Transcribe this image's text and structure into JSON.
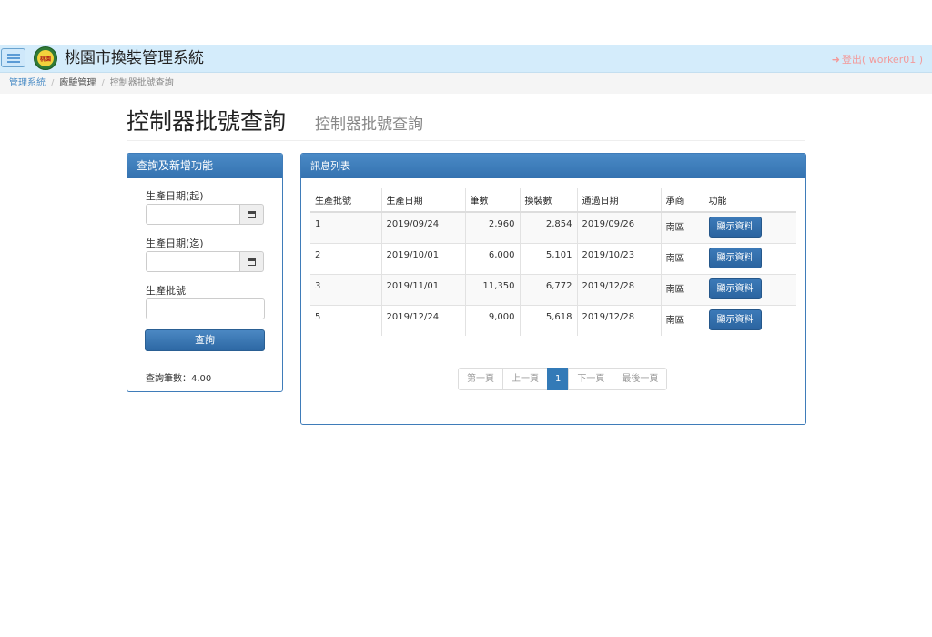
{
  "header": {
    "brand": "桃園市換裝管理系統",
    "logo_text": "桃園",
    "logout_label": "登出( worker01 )",
    "menu_icon": "hamburger-menu-icon",
    "logout_icon": "sign-out-icon"
  },
  "breadcrumb": [
    "管理系統",
    "廠驗管理",
    "控制器批號查詢"
  ],
  "page": {
    "title": "控制器批號查詢",
    "subtitle": "控制器批號查詢"
  },
  "query_panel": {
    "heading": "查詢及新增功能",
    "start_date_label": "生產日期(起)",
    "start_date_value": "",
    "end_date_label": "生產日期(迄)",
    "end_date_value": "",
    "batch_label": "生產批號",
    "batch_value": "",
    "query_button": "查詢",
    "count_text": "查詢筆數：4.00",
    "calendar_icon": "calendar-icon"
  },
  "list_panel": {
    "heading": "訊息列表",
    "columns": [
      "生產批號",
      "生產日期",
      "筆數",
      "換裝數",
      "通過日期",
      "承商",
      "功能"
    ],
    "rows": [
      {
        "batch": "1",
        "date": "2019/09/24",
        "count": "2,960",
        "replaced": "2,854",
        "pass_date": "2019/09/26",
        "vendor": "南區",
        "action": "顯示資料"
      },
      {
        "batch": "2",
        "date": "2019/10/01",
        "count": "6,000",
        "replaced": "5,101",
        "pass_date": "2019/10/23",
        "vendor": "南區",
        "action": "顯示資料"
      },
      {
        "batch": "3",
        "date": "2019/11/01",
        "count": "11,350",
        "replaced": "6,772",
        "pass_date": "2019/12/28",
        "vendor": "南區",
        "action": "顯示資料"
      },
      {
        "batch": "5",
        "date": "2019/12/24",
        "count": "9,000",
        "replaced": "5,618",
        "pass_date": "2019/12/28",
        "vendor": "南區",
        "action": "顯示資料"
      }
    ],
    "pagination": {
      "first": "第一頁",
      "prev": "上一頁",
      "current": "1",
      "next": "下一頁",
      "last": "最後一頁"
    }
  },
  "colors": {
    "navbar_bg": "#d4ecfb",
    "panel_header": "#3472b0",
    "button_primary": "#2b64a0",
    "logout_text": "#f39a9a",
    "active_page": "#337ab7"
  }
}
